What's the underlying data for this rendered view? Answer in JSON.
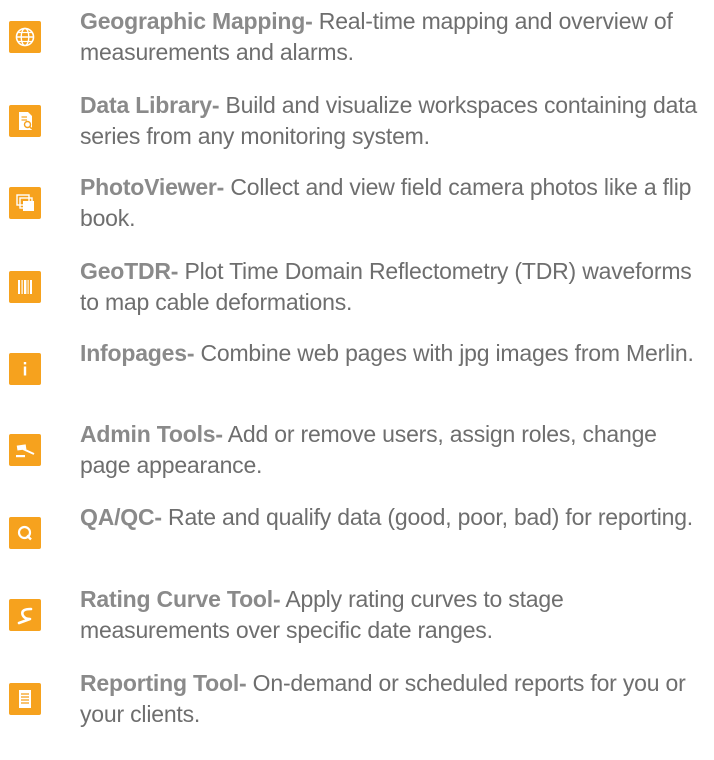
{
  "features": [
    {
      "icon": "globe-icon",
      "title": "Geographic Mapping-",
      "description": " Real-time mapping and overview of measurements and alarms."
    },
    {
      "icon": "document-search-icon",
      "title": "Data Library-",
      "description": " Build and visualize workspaces containing data series from any monitoring system."
    },
    {
      "icon": "photo-stack-icon",
      "title": "PhotoViewer-",
      "description": " Collect and view field camera photos like a flip book."
    },
    {
      "icon": "waveform-bars-icon",
      "title": "GeoTDR-",
      "description": " Plot Time Domain Reflectometry (TDR) waveforms to map cable deformations."
    },
    {
      "icon": "info-icon",
      "title": "Infopages-",
      "description": " Combine web pages with jpg images from Merlin."
    },
    {
      "icon": "gavel-icon",
      "title": "Admin Tools-",
      "description": " Add or remove users, assign roles, change page appearance."
    },
    {
      "icon": "q-letter-icon",
      "title": "QA/QC-",
      "description": " Rate and qualify data (good, poor, bad) for reporting."
    },
    {
      "icon": "s-curve-icon",
      "title": "Rating Curve Tool-",
      "description": " Apply rating curves to stage measurements over specific date ranges."
    },
    {
      "icon": "report-lines-icon",
      "title": "Reporting Tool-",
      "description": " On-demand or scheduled reports for you or your clients."
    }
  ],
  "colors": {
    "icon_background": "#f6a21e",
    "title_text": "#8a8a8a",
    "body_text": "#6e6e6e"
  }
}
